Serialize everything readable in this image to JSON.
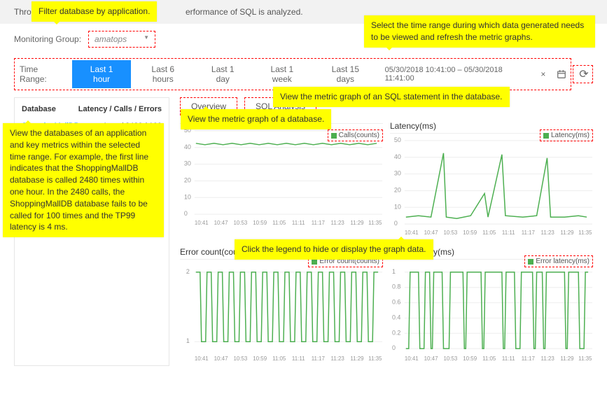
{
  "topbar": {
    "text_prefix": "Thro",
    "text_suffix": "erformance of SQL is analyzed."
  },
  "filter": {
    "label": "Monitoring Group:",
    "value": "amatops"
  },
  "time_range": {
    "label": "Time Range:",
    "options": [
      "Last 1 hour",
      "Last 6 hours",
      "Last 1 day",
      "Last 1 week",
      "Last 15 days"
    ],
    "active": "Last 1 hour",
    "date_range": "05/30/2018 10:41:00 – 05/30/2018 11:41:00",
    "close_icon": "×",
    "calendar_icon": "📅",
    "refresh_icon": "⟳"
  },
  "db_panel": {
    "col1": "Database",
    "col2": "Latency / Calls / Errors",
    "items": [
      {
        "name": "ShoppingMallDB",
        "metrics": "4 ms / 2480 / 100"
      }
    ]
  },
  "tabs": {
    "overview": "Overview",
    "sql": "SQL Analysis"
  },
  "charts": {
    "calls": {
      "title": "",
      "legend": "Calls(counts)"
    },
    "latency": {
      "title": "Latency(ms)",
      "legend": "Latency(ms)"
    },
    "error_count": {
      "title": "Error count(counts)",
      "legend": "Error count(counts)"
    },
    "error_latency": {
      "title": "Error latency(ms)",
      "legend": "Error latency(ms)"
    },
    "ticks_x": [
      "10:41",
      "10:47",
      "10:53",
      "10:59",
      "11:05",
      "11:11",
      "11:17",
      "11:23",
      "11:29",
      "11:35"
    ],
    "y_50": [
      "50",
      "40",
      "30",
      "20",
      "10",
      "0"
    ],
    "y_2": [
      "2",
      "1"
    ],
    "y_1": [
      "1",
      "0.8",
      "0.6",
      "0.4",
      "0.2",
      "0"
    ]
  },
  "annotations": {
    "filter_app": "Filter database by application.",
    "time_range_sel": "Select the time range during which data generated needs to be viewed and refresh the metric graphs.",
    "sql_view": "View the metric graph of an SQL statement in the database.",
    "db_view": "View the metric graph of a database.",
    "db_list": "View the databases of an application and key metrics within the selected time range. For example, the first line indicates that the ShoppingMallDB database is called 2480 times within one hour. In the 2480 calls, the ShoppingMallDB database fails to be called for 100 times and the TP99 latency is 4 ms.",
    "legend_click": "Click the legend to hide or display the graph data."
  },
  "chart_data": [
    {
      "type": "line",
      "title": "Calls(counts)",
      "xlabel": "",
      "ylabel": "",
      "ylim": [
        0,
        50
      ],
      "x": [
        "10:41",
        "10:47",
        "10:53",
        "10:59",
        "11:05",
        "11:11",
        "11:17",
        "11:23",
        "11:29",
        "11:35"
      ],
      "series": [
        {
          "name": "Calls(counts)",
          "values": [
            42,
            41,
            42,
            41,
            42,
            41,
            42,
            41,
            42,
            41
          ]
        }
      ]
    },
    {
      "type": "line",
      "title": "Latency(ms)",
      "xlabel": "",
      "ylabel": "",
      "ylim": [
        0,
        50
      ],
      "x": [
        "10:41",
        "10:47",
        "10:53",
        "10:59",
        "11:05",
        "11:11",
        "11:17",
        "11:23",
        "11:29",
        "11:35"
      ],
      "series": [
        {
          "name": "Latency(ms)",
          "values": [
            5,
            6,
            5,
            42,
            5,
            4,
            5,
            18,
            5,
            40,
            5,
            5,
            5,
            38,
            4,
            5
          ]
        }
      ]
    },
    {
      "type": "line",
      "title": "Error count(counts)",
      "xlabel": "",
      "ylabel": "",
      "ylim": [
        1,
        2
      ],
      "x": [
        "10:41",
        "10:47",
        "10:53",
        "10:59",
        "11:05",
        "11:11",
        "11:17",
        "11:23",
        "11:29",
        "11:35"
      ],
      "series": [
        {
          "name": "Error count(counts)",
          "values": [
            2,
            1,
            2,
            1,
            2,
            1,
            2,
            1,
            2,
            1,
            2,
            1,
            2,
            1,
            2,
            1,
            2,
            1,
            2,
            1
          ]
        }
      ]
    },
    {
      "type": "line",
      "title": "Error latency(ms)",
      "xlabel": "",
      "ylabel": "",
      "ylim": [
        0,
        1
      ],
      "x": [
        "10:41",
        "10:47",
        "10:53",
        "10:59",
        "11:05",
        "11:11",
        "11:17",
        "11:23",
        "11:29",
        "11:35"
      ],
      "series": [
        {
          "name": "Error latency(ms)",
          "values": [
            0,
            1,
            1,
            0,
            0,
            1,
            1,
            0,
            1,
            1,
            0,
            1,
            1,
            1,
            1,
            1,
            0,
            1,
            1,
            0,
            1,
            0,
            1,
            1
          ]
        }
      ]
    }
  ]
}
